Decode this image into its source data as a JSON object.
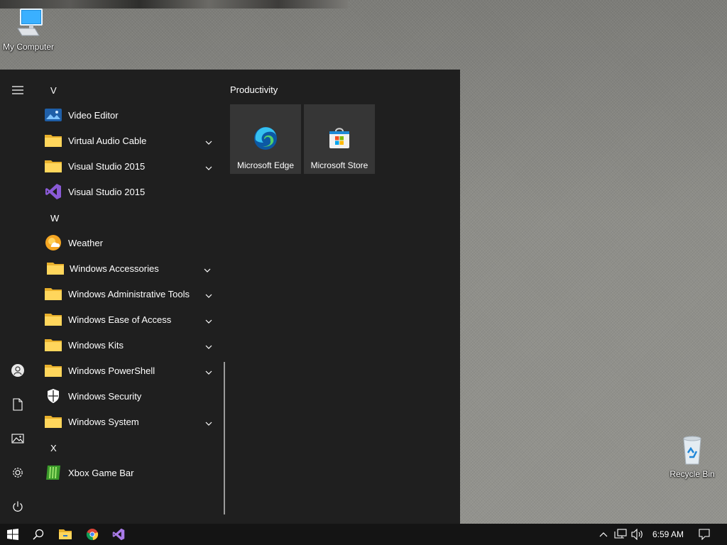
{
  "desktop": {
    "icons": [
      {
        "label": "My Computer",
        "icon": "computer-icon"
      },
      {
        "label": "Recycle Bin",
        "icon": "recycle-bin-icon"
      }
    ]
  },
  "start_menu": {
    "rail": [
      "hamburger-menu-icon",
      "user-account-icon",
      "documents-icon",
      "pictures-icon",
      "settings-gear-icon",
      "power-icon"
    ],
    "sections": [
      {
        "letter": "V",
        "apps": [
          {
            "name": "Video Editor",
            "icon": "video-editor-icon",
            "expandable": false
          },
          {
            "name": "Virtual Audio Cable",
            "icon": "folder-icon",
            "expandable": true
          },
          {
            "name": "Visual Studio 2015",
            "icon": "folder-icon",
            "expandable": true
          },
          {
            "name": "Visual Studio 2015",
            "icon": "visual-studio-icon",
            "expandable": false
          }
        ]
      },
      {
        "letter": "W",
        "apps": [
          {
            "name": "Weather",
            "icon": "weather-icon",
            "expandable": false
          },
          {
            "name": "Windows Accessories",
            "icon": "folder-icon",
            "expandable": true
          },
          {
            "name": "Windows Administrative Tools",
            "icon": "folder-icon",
            "expandable": true
          },
          {
            "name": "Windows Ease of Access",
            "icon": "folder-icon",
            "expandable": true
          },
          {
            "name": "Windows Kits",
            "icon": "folder-icon",
            "expandable": true
          },
          {
            "name": "Windows PowerShell",
            "icon": "folder-icon",
            "expandable": true
          },
          {
            "name": "Windows Security",
            "icon": "shield-icon",
            "expandable": false
          },
          {
            "name": "Windows System",
            "icon": "folder-icon",
            "expandable": true
          }
        ]
      },
      {
        "letter": "X",
        "apps": [
          {
            "name": "Xbox Game Bar",
            "icon": "xbox-game-bar-icon",
            "expandable": false
          }
        ]
      }
    ],
    "tiles": {
      "group_title": "Productivity",
      "items": [
        {
          "label": "Microsoft Edge",
          "icon": "edge-icon"
        },
        {
          "label": "Microsoft Store",
          "icon": "store-icon"
        }
      ]
    }
  },
  "taskbar": {
    "pinned": [
      "windows-start-icon",
      "search-icon",
      "file-explorer-icon",
      "chrome-icon",
      "visual-studio-icon"
    ],
    "tray": {
      "icons": [
        "chevron-up-icon",
        "network-icon",
        "volume-icon"
      ],
      "time": "6:59 AM",
      "notification_icon": "notification-icon"
    }
  }
}
